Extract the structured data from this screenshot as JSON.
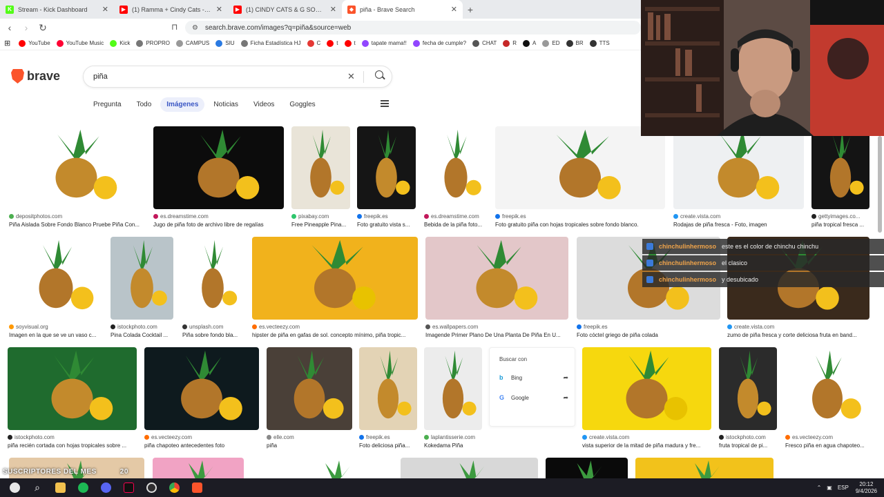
{
  "tabs": [
    {
      "title": "Stream - Kick Dashboard",
      "color": "#53fc18",
      "glyph": "K"
    },
    {
      "title": "(1) Ramma + Cindy Cats - Spotify Se",
      "color": "#ff0000",
      "glyph": "▶"
    },
    {
      "title": "(1) CINDY CATS & G SONY - LÁGRIM",
      "color": "#ff0000",
      "glyph": "▶"
    },
    {
      "title": "piña - Brave Search",
      "color": "#fb542b",
      "glyph": "◆",
      "active": true
    }
  ],
  "address": {
    "url": "search.brave.com/images?q=piña&source=web"
  },
  "bookmarks": [
    {
      "label": "YouTube",
      "color": "#ff0000"
    },
    {
      "label": "YouTube Music",
      "color": "#ff0033"
    },
    {
      "label": "Kick",
      "color": "#53fc18"
    },
    {
      "label": "PROPRO",
      "color": "#777"
    },
    {
      "label": "CAMPUS",
      "color": "#999"
    },
    {
      "label": "SIU",
      "color": "#2a7ae2"
    },
    {
      "label": "Ficha Estadística HJ",
      "color": "#777"
    },
    {
      "label": "C",
      "color": "#e53935"
    },
    {
      "label": "t",
      "color": "#ff0000"
    },
    {
      "label": "t",
      "color": "#ff0000"
    },
    {
      "label": "tapate mama!!",
      "color": "#9146ff"
    },
    {
      "label": "fecha de cumple?",
      "color": "#9146ff"
    },
    {
      "label": "CHAT",
      "color": "#555"
    },
    {
      "label": "R",
      "color": "#c62828"
    },
    {
      "label": "A",
      "color": "#111"
    },
    {
      "label": "ED",
      "color": "#999"
    },
    {
      "label": "BR",
      "color": "#333"
    },
    {
      "label": "TTS",
      "color": "#333"
    }
  ],
  "brand": {
    "name": "brave"
  },
  "search": {
    "query": "piña"
  },
  "filters": [
    "Pregunta",
    "Todo",
    "Imágenes",
    "Noticias",
    "Videos",
    "Goggles"
  ],
  "results": [
    {
      "source": "depositphotos.com",
      "caption": "Piña Aislada Sobre Fondo Blanco Pruebe Piña Con...",
      "dot": "#4caf50",
      "bg": "#ffffff"
    },
    {
      "source": "es.dreamstime.com",
      "caption": "Jugo de piña foto de archivo libre de regalías",
      "dot": "#c2185b",
      "bg": "#0c0c0c"
    },
    {
      "source": "pixabay.com",
      "caption": "Free Pineapple Pina...",
      "dot": "#2ec66d",
      "bg": "#e9e4d8"
    },
    {
      "source": "freepik.es",
      "caption": "Foto gratuito vista s...",
      "dot": "#1273eb",
      "bg": "#151515"
    },
    {
      "source": "es.dreamstime.com",
      "caption": "Bebida de la piña foto...",
      "dot": "#c2185b",
      "bg": "#ffffff"
    },
    {
      "source": "freepik.es",
      "caption": "Foto gratuito piña con hojas tropicales sobre fondo blanco.",
      "dot": "#1273eb",
      "bg": "#f4f4f4"
    },
    {
      "source": "create.vista.com",
      "caption": "Rodajas de piña fresca - Foto, imagen",
      "dot": "#2196f3",
      "bg": "#eef0f2"
    },
    {
      "source": "gettyimages.co...",
      "caption": "piña tropical fresca ...",
      "dot": "#222",
      "bg": "#141414"
    },
    {
      "source": "soyvisual.org",
      "caption": "Imagen en la que se ve un vaso c...",
      "dot": "#ff9800",
      "bg": "#ffffff"
    },
    {
      "source": "istockphoto.com",
      "caption": "Pina Colada Cocktail ...",
      "dot": "#222",
      "bg": "#b9c4c9"
    },
    {
      "source": "unsplash.com",
      "caption": "Piña sobre fondo bla...",
      "dot": "#333",
      "bg": "#ffffff"
    },
    {
      "source": "es.vecteezy.com",
      "caption": "hipster de piña en gafas de sol. concepto mínimo, piña tropic...",
      "dot": "#ff6d00",
      "bg": "#f1b21c"
    },
    {
      "source": "es.wallpapers.com",
      "caption": "Imagende Primer Plano De Una Planta De Piña En U...",
      "dot": "#555",
      "bg": "#e3c7c9"
    },
    {
      "source": "freepik.es",
      "caption": "Foto cóctel griego de piña colada",
      "dot": "#1273eb",
      "bg": "#dcdcdc"
    },
    {
      "source": "create.vista.com",
      "caption": "zumo de piña fresca y corte deliciosa fruta en band...",
      "dot": "#2196f3",
      "bg": "#3a2a1c"
    },
    {
      "source": "istockphoto.com",
      "caption": "piña recién cortada con hojas tropicales sobre ...",
      "dot": "#222",
      "bg": "#1f6b2e"
    },
    {
      "source": "es.vecteezy.com",
      "caption": "piña chapoteo antecedentes foto",
      "dot": "#ff6d00",
      "bg": "#0e1a1e"
    },
    {
      "source": "elle.com",
      "caption": "piña",
      "dot": "#888",
      "bg": "#4a4038"
    },
    {
      "source": "freepik.es",
      "caption": "Foto deliciosa piña...",
      "dot": "#1273eb",
      "bg": "#e3d3b5"
    },
    {
      "source": "laplantisserie.com",
      "caption": "Kokedama Piña",
      "dot": "#4caf50",
      "bg": "#ececec"
    },
    {
      "source": "create.vista.com",
      "caption": "vista superior de la mitad de piña madura y fre...",
      "dot": "#2196f3",
      "bg": "#f6d80e"
    },
    {
      "source": "istockphoto.com",
      "caption": "fruta tropical de pi...",
      "dot": "#222",
      "bg": "#2b2b2b"
    },
    {
      "source": "es.vecteezy.com",
      "caption": "Fresco piña en agua chapoteo...",
      "dot": "#ff6d00",
      "bg": "#ffffff"
    }
  ],
  "bottom_row_colors": [
    "#e4c9a6",
    "#f1a3c4",
    "#ffffff",
    "#d8d8d8",
    "#0a0a0a",
    "#f2c21b"
  ],
  "search_with": {
    "title": "Buscar con",
    "options": [
      "Bing",
      "Google"
    ]
  },
  "chat": [
    {
      "user": "chinchulinhermoso",
      "message": "este es el color de chinchu chinchu"
    },
    {
      "user": "chinchulinhermoso",
      "message": "el clasico"
    },
    {
      "user": "chinchulinhermoso",
      "message": "y desubicado"
    }
  ],
  "overlay": {
    "label": "SUSCRIPTORES DEL MES",
    "count": "20"
  },
  "tray": {
    "lang": "ESP",
    "time": "20:12",
    "date": "9/4/2026"
  }
}
